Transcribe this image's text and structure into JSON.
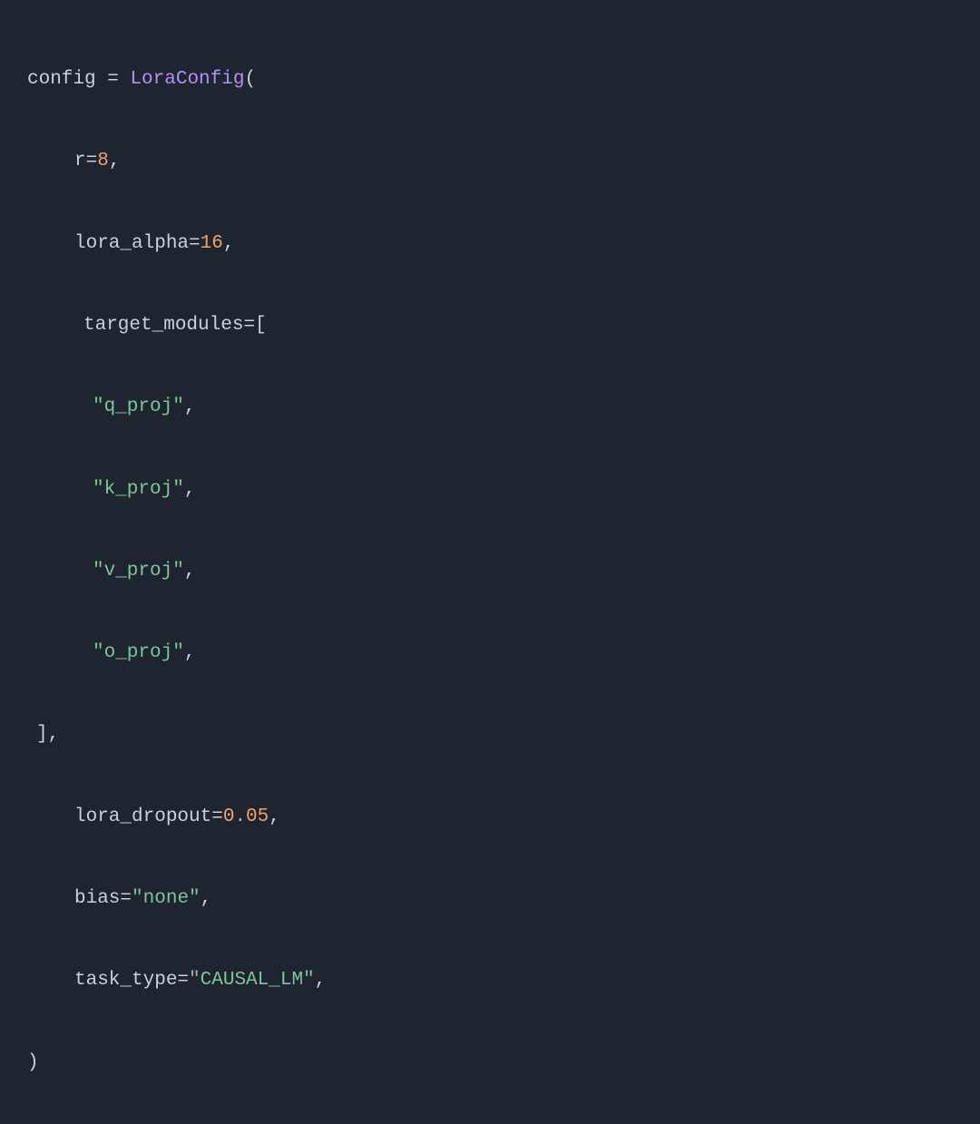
{
  "code": {
    "var_name": "config",
    "eq": " = ",
    "class_name": "LoraConfig",
    "open_paren": "(",
    "close_paren": ")",
    "params": {
      "r": {
        "name": "r",
        "eq": "=",
        "value": "8",
        "comma": ","
      },
      "lora_alpha": {
        "name": "lora_alpha",
        "eq": "=",
        "value": "16",
        "comma": ","
      },
      "target_modules": {
        "name": "target_modules",
        "eq": "=",
        "open": "[",
        "close": "]",
        "comma": ","
      },
      "modules": {
        "q": {
          "value": "\"q_proj\"",
          "comma": ","
        },
        "k": {
          "value": "\"k_proj\"",
          "comma": ","
        },
        "v": {
          "value": "\"v_proj\"",
          "comma": ","
        },
        "o": {
          "value": "\"o_proj\"",
          "comma": ","
        }
      },
      "lora_dropout": {
        "name": "lora_dropout",
        "eq": "=",
        "value": "0.05",
        "comma": ","
      },
      "bias": {
        "name": "bias",
        "eq": "=",
        "value": "\"none\"",
        "comma": ","
      },
      "task_type": {
        "name": "task_type",
        "eq": "=",
        "value": "\"CAUSAL_LM\"",
        "comma": ","
      }
    }
  }
}
